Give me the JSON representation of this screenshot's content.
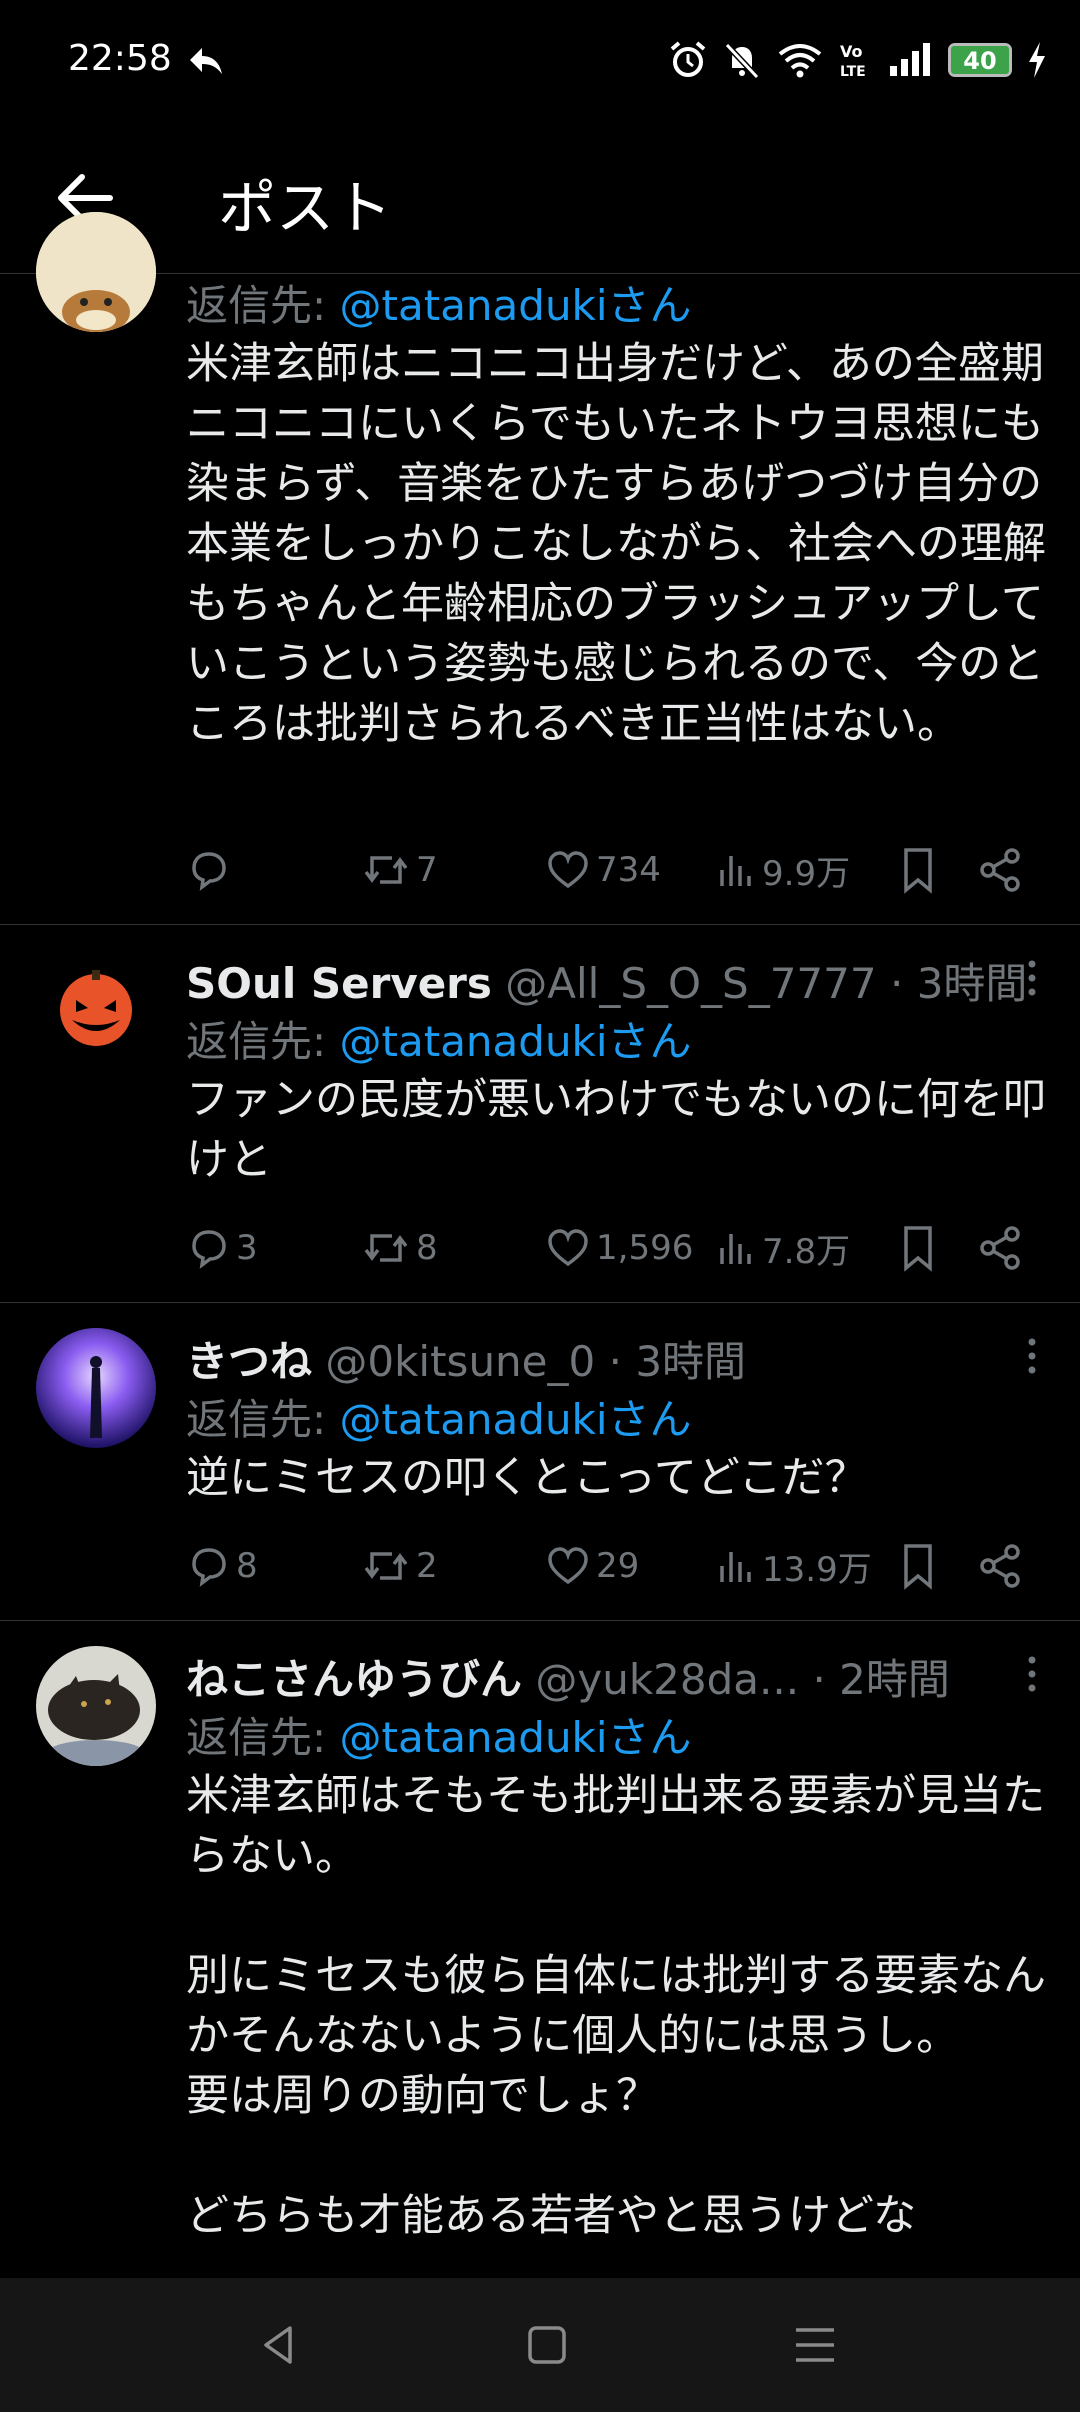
{
  "status_bar": {
    "time": "22:58",
    "battery": "40",
    "network_label": "VoLTE"
  },
  "app_bar": {
    "title": "ポスト"
  },
  "tweets": [
    {
      "reply_prefix": "返信先: ",
      "reply_to": "@tatanadukiさん",
      "text": "米津玄師はニコニコ出身だけど、あの全盛期ニコニコにいくらでもいたネトウヨ思想にも染まらず、音楽をひたすらあげつづけ自分の本業をしっかりこなしながら、社会への理解もちゃんと年齢相応のブラッシュアップしていこうという姿勢も感じられるので、今のところは批判さられるべき正当性はない。",
      "replies": "",
      "reposts": "7",
      "likes": "734",
      "views": "9.9万"
    },
    {
      "name": "SOul Servers",
      "handle": "@All_S_O_S_7777",
      "time": "3時間",
      "reply_prefix": "返信先: ",
      "reply_to": "@tatanadukiさん",
      "text": "ファンの民度が悪いわけでもないのに何を叩けと",
      "replies": "3",
      "reposts": "8",
      "likes": "1,596",
      "views": "7.8万"
    },
    {
      "name": "きつね",
      "handle": "@0kitsune_0",
      "time": "3時間",
      "reply_prefix": "返信先: ",
      "reply_to": "@tatanadukiさん",
      "text": "逆にミセスの叩くとこってどこだ？",
      "replies": "8",
      "reposts": "2",
      "likes": "29",
      "views": "13.9万"
    },
    {
      "name": "ねこさんゆうびん",
      "handle": "@yuk28da...",
      "time": "2時間",
      "reply_prefix": "返信先: ",
      "reply_to": "@tatanadukiさん",
      "text": "米津玄師はそもそも批判出来る要素が見当たらない。\n\n別にミセスも彼ら自体には批判する要素なんかそんなないように個人的には思うし。\n要は周りの動向でしょ？\n\nどちらも才能ある若者やと思うけどな"
    }
  ],
  "colors": {
    "background": "#000000",
    "text": "#e7e9ea",
    "muted": "#71767b",
    "link": "#1d9bf0",
    "divider": "#2f3336",
    "battery": "#3ca34a"
  }
}
